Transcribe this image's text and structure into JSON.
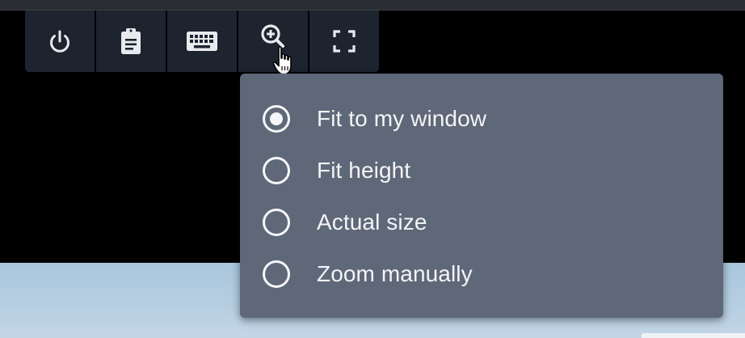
{
  "toolbar": {
    "buttons": [
      {
        "icon": "power-icon"
      },
      {
        "icon": "clipboard-icon"
      },
      {
        "icon": "keyboard-icon"
      },
      {
        "icon": "zoom-in-icon"
      },
      {
        "icon": "fullscreen-icon"
      }
    ]
  },
  "zoom_menu": {
    "selected": "Fit to my window",
    "options": [
      {
        "label": "Fit to my window",
        "checked": true
      },
      {
        "label": "Fit height",
        "checked": false
      },
      {
        "label": "Actual size",
        "checked": false
      },
      {
        "label": "Zoom manually",
        "checked": false
      }
    ]
  },
  "colors": {
    "toolbar_bg": "#1d2430",
    "menu_bg": "#5f6879",
    "icon": "#e8eaed",
    "desktop_bg": "#b7cfe2"
  }
}
